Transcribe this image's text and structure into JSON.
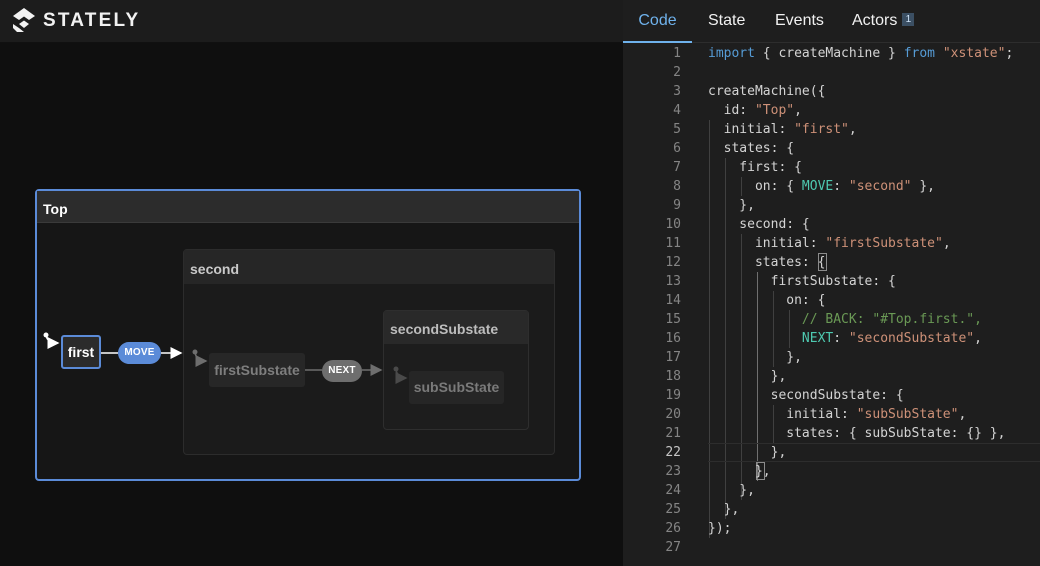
{
  "app": {
    "brand": "STATELY",
    "logo_icon": "stately-logo-icon"
  },
  "tabs": [
    {
      "label": "Code",
      "active": true
    },
    {
      "label": "State",
      "active": false
    },
    {
      "label": "Events",
      "active": false
    },
    {
      "label": "Actors",
      "active": false,
      "badge": "1"
    }
  ],
  "diagram": {
    "states": {
      "top": "Top",
      "first": "first",
      "second": "second",
      "first_substate": "firstSubstate",
      "second_substate": "secondSubstate",
      "sub_sub_state": "subSubState"
    },
    "events": {
      "move": "MOVE",
      "next": "NEXT"
    },
    "colors": {
      "active": "#5b8bd8",
      "inactive": "#6e6e6e"
    }
  },
  "editor": {
    "current_line": 22,
    "colors": {
      "keyword": "#569cd6",
      "string": "#ce9178",
      "event": "#4ec9b0",
      "comment": "#6a9955",
      "text": "#d4d4d4"
    },
    "lines": [
      {
        "n": "1",
        "segs": [
          [
            "import",
            "kw"
          ],
          [
            " { createMachine } ",
            ""
          ],
          [
            "from",
            "kw"
          ],
          [
            " ",
            ""
          ],
          [
            "\"xstate\"",
            "str"
          ],
          [
            ";",
            ""
          ]
        ]
      },
      {
        "n": "2",
        "segs": []
      },
      {
        "n": "3",
        "segs": [
          [
            "createMachine({",
            ""
          ]
        ]
      },
      {
        "n": "4",
        "segs": [
          [
            "  id: ",
            ""
          ],
          [
            "\"Top\"",
            "str"
          ],
          [
            ",",
            ""
          ]
        ]
      },
      {
        "n": "5",
        "segs": [
          [
            "  initial: ",
            ""
          ],
          [
            "\"first\"",
            "str"
          ],
          [
            ",",
            ""
          ]
        ]
      },
      {
        "n": "6",
        "segs": [
          [
            "  states: {",
            ""
          ]
        ]
      },
      {
        "n": "7",
        "segs": [
          [
            "    first: {",
            ""
          ]
        ]
      },
      {
        "n": "8",
        "segs": [
          [
            "      on: { ",
            ""
          ],
          [
            "MOVE",
            "prop"
          ],
          [
            ": ",
            ""
          ],
          [
            "\"second\"",
            "str"
          ],
          [
            " },",
            ""
          ]
        ]
      },
      {
        "n": "9",
        "segs": [
          [
            "    },",
            ""
          ]
        ]
      },
      {
        "n": "10",
        "segs": [
          [
            "    second: {",
            ""
          ]
        ]
      },
      {
        "n": "11",
        "segs": [
          [
            "      initial: ",
            ""
          ],
          [
            "\"firstSubstate\"",
            "str"
          ],
          [
            ",",
            ""
          ]
        ]
      },
      {
        "n": "12",
        "segs": [
          [
            "      states: {",
            ""
          ]
        ]
      },
      {
        "n": "13",
        "segs": [
          [
            "        firstSubstate: {",
            ""
          ]
        ]
      },
      {
        "n": "14",
        "segs": [
          [
            "          on: {",
            ""
          ]
        ]
      },
      {
        "n": "15",
        "segs": [
          [
            "            ",
            ""
          ],
          [
            "// BACK: \"#Top.first.\",",
            "com"
          ]
        ]
      },
      {
        "n": "16",
        "segs": [
          [
            "            ",
            ""
          ],
          [
            "NEXT",
            "prop"
          ],
          [
            ": ",
            ""
          ],
          [
            "\"secondSubstate\"",
            "str"
          ],
          [
            ",",
            ""
          ]
        ]
      },
      {
        "n": "17",
        "segs": [
          [
            "          },",
            ""
          ]
        ]
      },
      {
        "n": "18",
        "segs": [
          [
            "        },",
            ""
          ]
        ]
      },
      {
        "n": "19",
        "segs": [
          [
            "        secondSubstate: {",
            ""
          ]
        ]
      },
      {
        "n": "20",
        "segs": [
          [
            "          initial: ",
            ""
          ],
          [
            "\"subSubState\"",
            "str"
          ],
          [
            ",",
            ""
          ]
        ]
      },
      {
        "n": "21",
        "segs": [
          [
            "          states: { subSubState: {} },",
            ""
          ]
        ]
      },
      {
        "n": "22",
        "segs": [
          [
            "        },",
            ""
          ]
        ]
      },
      {
        "n": "23",
        "segs": [
          [
            "      },",
            ""
          ]
        ]
      },
      {
        "n": "24",
        "segs": [
          [
            "    },",
            ""
          ]
        ]
      },
      {
        "n": "25",
        "segs": [
          [
            "  },",
            ""
          ]
        ]
      },
      {
        "n": "26",
        "segs": [
          [
            "});",
            ""
          ]
        ]
      },
      {
        "n": "27",
        "segs": []
      }
    ]
  }
}
